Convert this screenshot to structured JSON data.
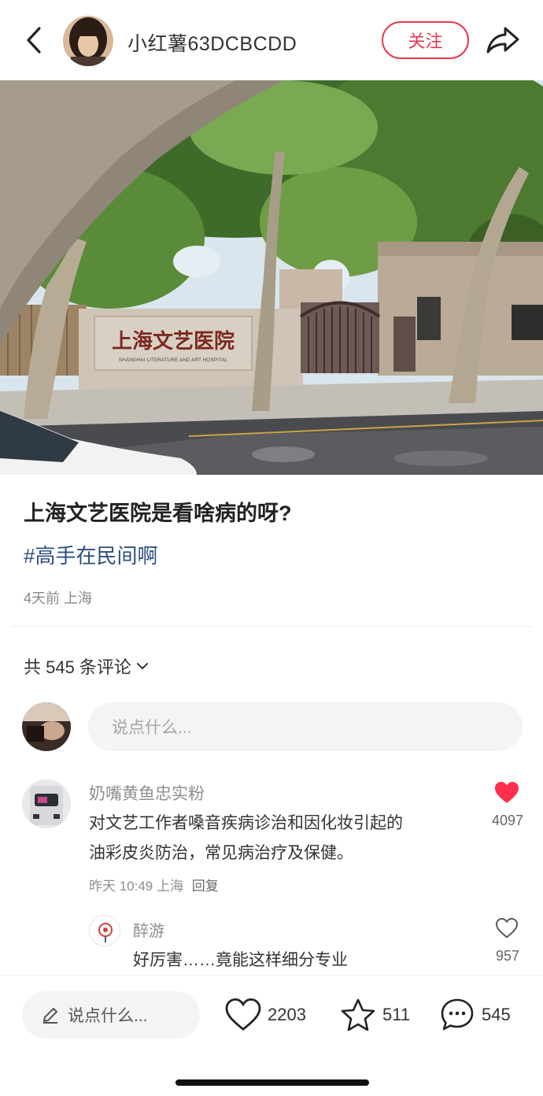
{
  "header": {
    "author_name": "小红薯63DCBCDD",
    "follow_label": "关注"
  },
  "post": {
    "title": "上海文艺医院是看啥病的呀?",
    "tag": "#高手在民间啊",
    "meta": "4天前 上海",
    "sign_text": "上海文艺医院",
    "sign_subtext": "SHANGHAI LITERATURE AND ART HOSPITAL"
  },
  "comments_section": {
    "count_label": "共 545 条评论",
    "input_placeholder": "说点什么..."
  },
  "comments": [
    {
      "name": "奶嘴黄鱼忠实粉",
      "lines": [
        "对文艺工作者嗓音疾病诊治和因化妆引起的",
        "油彩皮炎防治，常见病治疗及保健。"
      ],
      "time": "昨天 10:49 上海",
      "reply_label": "回复",
      "likes": "4097",
      "liked": true,
      "reply": {
        "name": "醉游",
        "text": "好厉害……竟能这样细分专业",
        "likes": "957"
      }
    }
  ],
  "bottom_bar": {
    "input_placeholder": "说点什么...",
    "likes": "2203",
    "collects": "511",
    "comments": "545"
  },
  "colors": {
    "accent": "#e8374f",
    "tag": "#2d4f7d"
  },
  "icons": [
    "back-icon",
    "share-icon",
    "heart-icon",
    "star-icon",
    "comment-bubble-icon",
    "pencil-icon",
    "chevron-down-icon"
  ]
}
